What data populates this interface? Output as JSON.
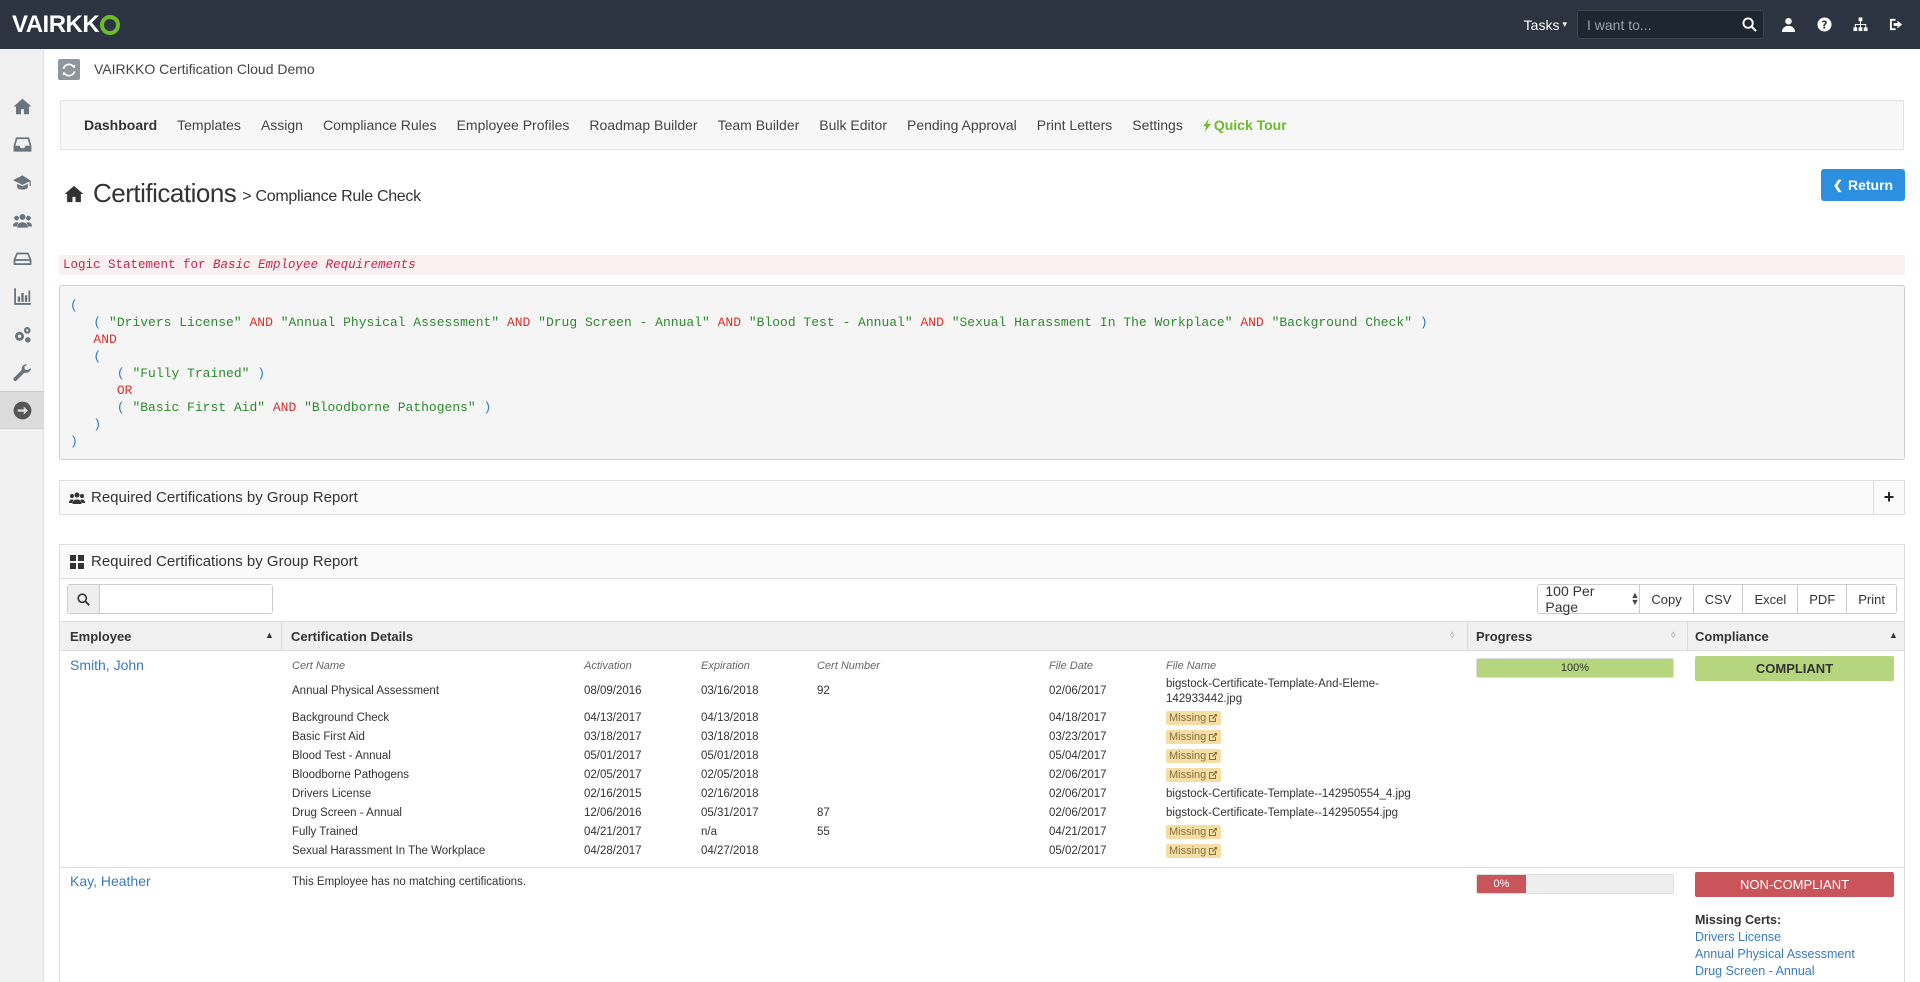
{
  "topbar": {
    "logo": "VAIRKKO",
    "tasks_label": "Tasks",
    "search_placeholder": "I want to...",
    "icons": [
      "search-icon",
      "user-icon",
      "help-icon",
      "sitemap-icon",
      "sign-out-icon"
    ]
  },
  "app": {
    "title": "VAIRKKO Certification Cloud Demo"
  },
  "sidebar": {
    "items": [
      "home-icon",
      "inbox-icon",
      "graduation-cap-icon",
      "users-icon",
      "hdd-icon",
      "bar-chart-icon",
      "cogs-icon",
      "wrench-icon",
      "arrow-circle-right-icon"
    ]
  },
  "nav": {
    "items": [
      "Dashboard",
      "Templates",
      "Assign",
      "Compliance Rules",
      "Employee Profiles",
      "Roadmap Builder",
      "Team Builder",
      "Bulk Editor",
      "Pending Approval",
      "Print Letters",
      "Settings"
    ],
    "quick_tour": "Quick Tour"
  },
  "page": {
    "title": "Certifications",
    "subtitle": "> Compliance Rule Check",
    "return_label": "Return"
  },
  "logic": {
    "label_prefix": "Logic Statement for",
    "label_name": "Basic Employee Requirements"
  },
  "panels": {
    "collapsed_title": "Required Certifications by Group Report",
    "report_title": "Required Certifications by Group Report"
  },
  "table": {
    "per_page": "100 Per Page",
    "buttons": [
      "Copy",
      "CSV",
      "Excel",
      "PDF",
      "Print"
    ],
    "headers": {
      "employee": "Employee",
      "details": "Certification Details",
      "progress": "Progress",
      "compliance": "Compliance"
    },
    "cert_headers": [
      "Cert Name",
      "Activation",
      "Expiration",
      "Cert Number",
      "File Date",
      "File Name"
    ],
    "rows": [
      {
        "employee": "Smith, John",
        "progress": 100,
        "progress_label": "100%",
        "compliance": "COMPLIANT",
        "certs": [
          [
            "Annual Physical Assessment",
            "08/09/2016",
            "03/16/2018",
            "92",
            "02/06/2017",
            "bigstock-Certificate-Template-And-Eleme-",
            "142933442.jpg"
          ],
          [
            "Background Check",
            "04/13/2017",
            "04/13/2018",
            "",
            "04/18/2017",
            "Missing",
            ""
          ],
          [
            "Basic First Aid",
            "03/18/2017",
            "03/18/2018",
            "",
            "03/23/2017",
            "Missing",
            ""
          ],
          [
            "Blood Test - Annual",
            "05/01/2017",
            "05/01/2018",
            "",
            "05/04/2017",
            "Missing",
            ""
          ],
          [
            "Bloodborne Pathogens",
            "02/05/2017",
            "02/05/2018",
            "",
            "02/06/2017",
            "Missing",
            ""
          ],
          [
            "Drivers License",
            "02/16/2015",
            "02/16/2018",
            "",
            "02/06/2017",
            "bigstock-Certificate-Template--142950554_4.jpg",
            ""
          ],
          [
            "Drug Screen - Annual",
            "12/06/2016",
            "05/31/2017",
            "87",
            "02/06/2017",
            "bigstock-Certificate-Template--142950554.jpg",
            ""
          ],
          [
            "Fully Trained",
            "04/21/2017",
            "n/a",
            "55",
            "04/21/2017",
            "Missing",
            ""
          ],
          [
            "Sexual Harassment In The Workplace",
            "04/28/2017",
            "04/27/2018",
            "",
            "05/02/2017",
            "Missing",
            ""
          ]
        ]
      },
      {
        "employee": "Kay, Heather",
        "note": "This Employee has no matching certifications.",
        "progress": 0,
        "progress_label": "0%",
        "compliance": "NON-COMPLIANT",
        "missing_title": "Missing Certs:",
        "missing": [
          "Drivers License",
          "Annual Physical Assessment",
          "Drug Screen - Annual"
        ]
      }
    ]
  },
  "colors": {
    "topbar": "#2b3440",
    "brand_green": "#6dbb2a",
    "primary": "#2d8fe0",
    "compliant": "#b5d67f",
    "noncompliant": "#c9555a",
    "missing_bg": "#f5dea6"
  }
}
